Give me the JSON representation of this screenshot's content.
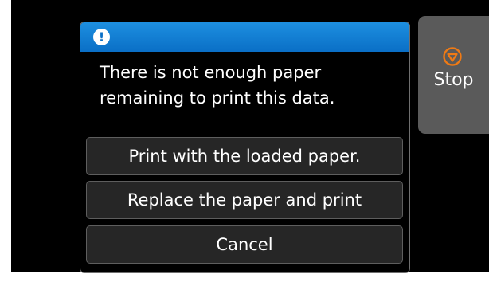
{
  "dialog": {
    "icon": "exclamation-icon",
    "icon_glyph": "!",
    "message": "There is not enough paper\nremaining to print this data.",
    "options": [
      "Print with the loaded paper.",
      "Replace the paper and print",
      "Cancel"
    ]
  },
  "side": {
    "stop_label": "Stop",
    "stop_icon": "stop-icon",
    "stop_icon_color": "#f07a14"
  },
  "colors": {
    "header_blue": "#0a6fc6",
    "button_bg": "#262626",
    "side_button_bg": "#5a5a5a"
  }
}
